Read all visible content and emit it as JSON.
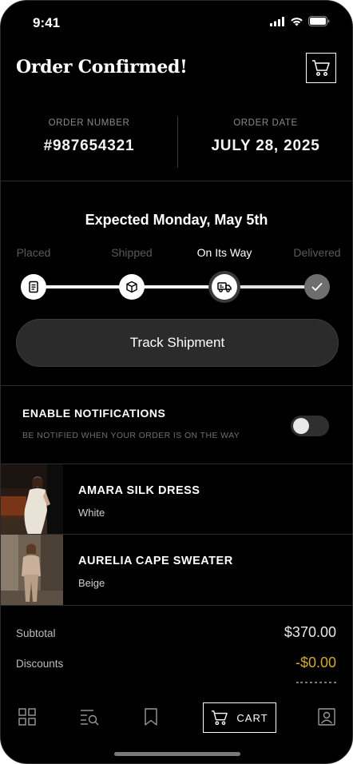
{
  "status_bar": {
    "time": "9:41"
  },
  "header": {
    "title": "Order Confirmed!"
  },
  "order": {
    "number_label": "ORDER NUMBER",
    "number_value": "#987654321",
    "date_label": "ORDER DATE",
    "date_value": "JULY 28, 2025"
  },
  "shipment": {
    "expected": "Expected Monday, May 5th",
    "steps": [
      {
        "label": "Placed",
        "state": "done",
        "icon": "receipt-icon"
      },
      {
        "label": "Shipped",
        "state": "done",
        "icon": "package-icon"
      },
      {
        "label": "On Its Way",
        "state": "current",
        "icon": "truck-icon"
      },
      {
        "label": "Delivered",
        "state": "pending",
        "icon": "check-icon"
      }
    ],
    "track_button": "Track Shipment"
  },
  "notifications": {
    "title": "ENABLE NOTIFICATIONS",
    "subtitle": "BE NOTIFIED WHEN YOUR ORDER IS ON THE WAY",
    "enabled": false
  },
  "items": [
    {
      "name": "AMARA SILK DRESS",
      "color": "White"
    },
    {
      "name": "AURELIA CAPE SWEATER",
      "color": "Beige"
    }
  ],
  "totals": {
    "subtotal_label": "Subtotal",
    "subtotal_value": "$370.00",
    "discounts_label": "Discounts",
    "discounts_value": "-$0.00"
  },
  "tabbar": {
    "cart_label": "CART",
    "tabs": [
      "grid-icon",
      "search-list-icon",
      "bookmark-icon",
      "cart-icon",
      "profile-icon"
    ]
  },
  "colors": {
    "background": "#000000",
    "discount": "#d4a82a",
    "progress_done": "#ffffff",
    "progress_pending": "#6e6e6e"
  }
}
